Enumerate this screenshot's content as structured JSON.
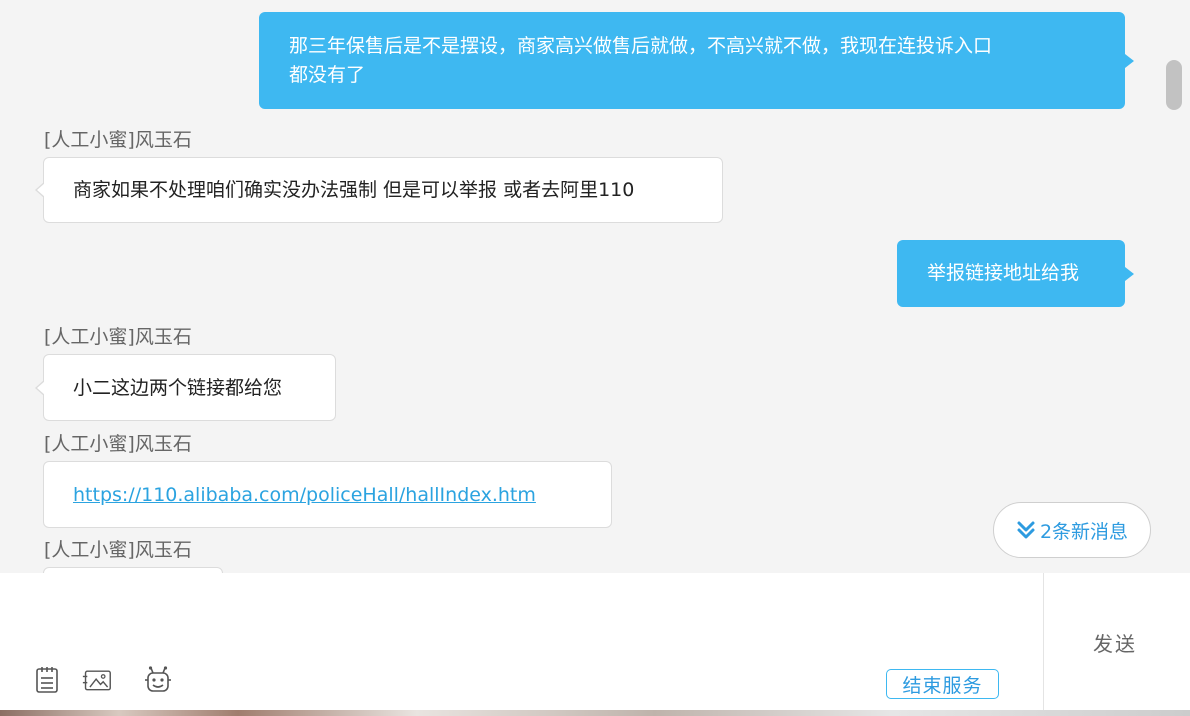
{
  "messages": [
    {
      "type": "out",
      "lines": [
        "那三年保售后是不是摆设，商家高兴做售后就做，不高兴就不做，我现在连投诉入口",
        "都没有了"
      ]
    },
    {
      "type": "in",
      "sender": "[人工小蜜]风玉石",
      "text": "商家如果不处理咱们确实没办法强制 但是可以举报 或者去阿里110"
    },
    {
      "type": "out",
      "text": "举报链接地址给我"
    },
    {
      "type": "in",
      "sender": "[人工小蜜]风玉石",
      "text": "小二这边两个链接都给您"
    },
    {
      "type": "in",
      "sender": "[人工小蜜]风玉石",
      "link": "https://110.alibaba.com/policeHall/hallIndex.htm"
    },
    {
      "type": "in",
      "sender": "[人工小蜜]风玉石",
      "text": ""
    }
  ],
  "new_messages_label": "2条新消息",
  "send_label": "发送",
  "end_service_label": "结束服务",
  "toolbar": {
    "icons": [
      "notepad-icon",
      "image-icon",
      "robot-emoji-icon"
    ]
  },
  "colors": {
    "outgoing_bubble": "#3eb8f1",
    "link": "#2ba3e0",
    "accent": "#2d9be0"
  }
}
